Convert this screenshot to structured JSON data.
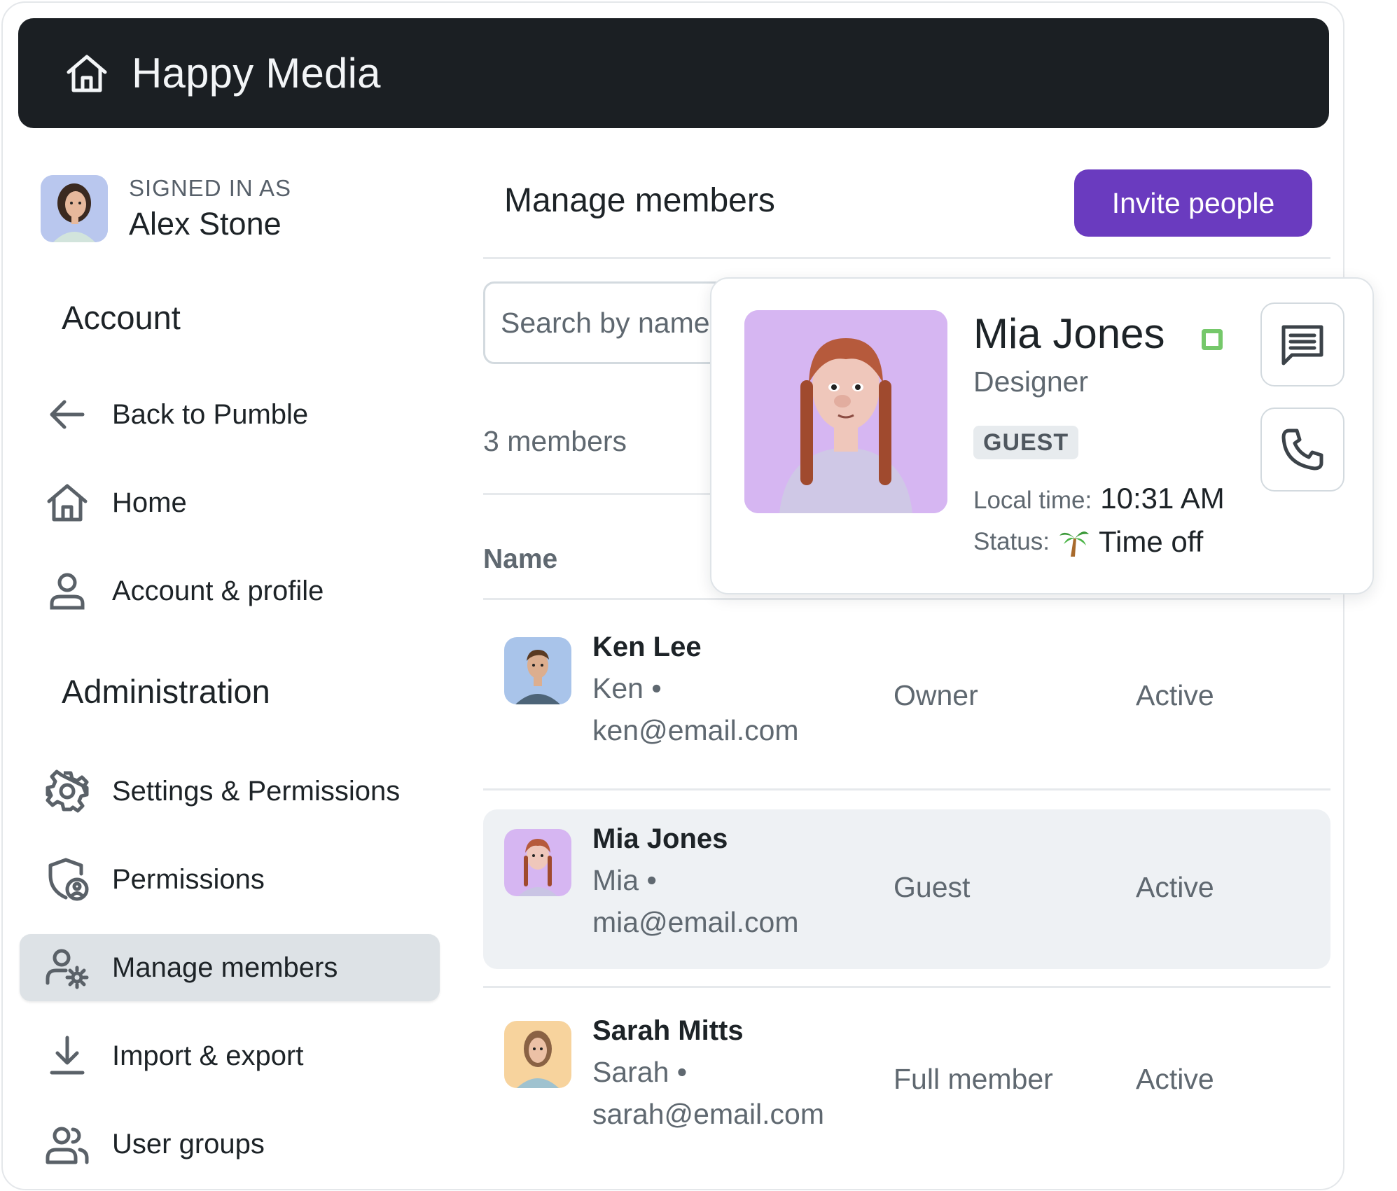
{
  "header": {
    "title": "Happy Media",
    "icon": "home-icon"
  },
  "signed_in": {
    "caption": "SIGNED IN AS",
    "name": "Alex Stone"
  },
  "sidebar": {
    "account_title": "Account",
    "admin_title": "Administration",
    "items": [
      {
        "label": "Back to Pumble",
        "icon": "arrow-left-icon"
      },
      {
        "label": "Home",
        "icon": "home-icon"
      },
      {
        "label": "Account & profile",
        "icon": "user-icon"
      },
      {
        "label": "Settings & Permissions",
        "icon": "gear-icon"
      },
      {
        "label": "Permissions",
        "icon": "shield-user-icon"
      },
      {
        "label": "Manage members",
        "icon": "user-gear-icon",
        "active": true
      },
      {
        "label": "Import & export",
        "icon": "download-icon"
      },
      {
        "label": "User groups",
        "icon": "users-icon"
      }
    ]
  },
  "main": {
    "title": "Manage members",
    "invite_label": "Invite people",
    "search_placeholder": "Search by name",
    "count": "3 members",
    "col_name": "Name",
    "members": [
      {
        "name": "Ken Lee",
        "sub": "Ken •",
        "email": "ken@email.com",
        "role": "Owner",
        "status": "Active"
      },
      {
        "name": "Mia Jones",
        "sub": "Mia •",
        "email": "mia@email.com",
        "role": "Guest",
        "status": "Active"
      },
      {
        "name": "Sarah Mitts",
        "sub": "Sarah •",
        "email": "sarah@email.com",
        "role": "Full member",
        "status": "Active"
      }
    ]
  },
  "profile_card": {
    "name": "Mia Jones",
    "title": "Designer",
    "badge": "GUEST",
    "local_time_label": "Local time:",
    "local_time": "10:31 AM",
    "status_label": "Status:",
    "status_icon": "palm-tree-icon",
    "status": "Time off"
  },
  "colors": {
    "header_bg": "#1b1f23",
    "accent": "#6a3bbf",
    "presence": "#75c86a",
    "active_nav_bg": "#dde2e6",
    "highlight_row_bg": "#eef1f4"
  }
}
